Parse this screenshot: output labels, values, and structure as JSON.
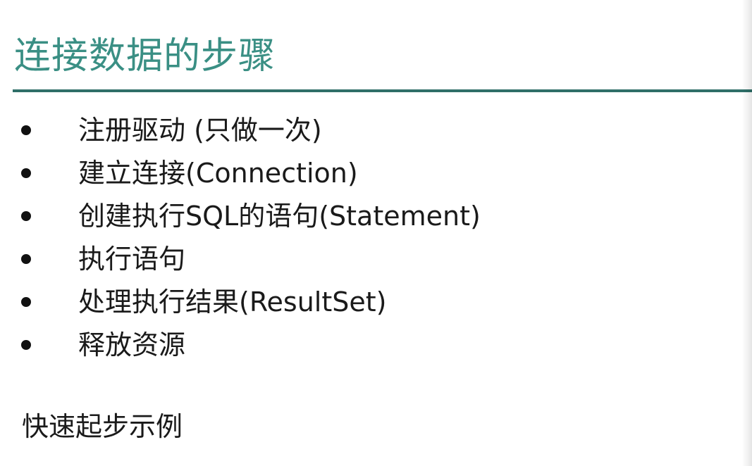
{
  "slide": {
    "title": "连接数据的步骤",
    "bullets": [
      "注册驱动 (只做一次)",
      "建立连接(Connection)",
      "创建执行SQL的语句(Statement)",
      "执行语句",
      "处理执行结果(ResultSet)",
      "释放资源"
    ],
    "footer": "快速起步示例"
  },
  "colors": {
    "title": "#3a8f84",
    "rule": "#2f6f68",
    "text": "#1a1a1a"
  }
}
